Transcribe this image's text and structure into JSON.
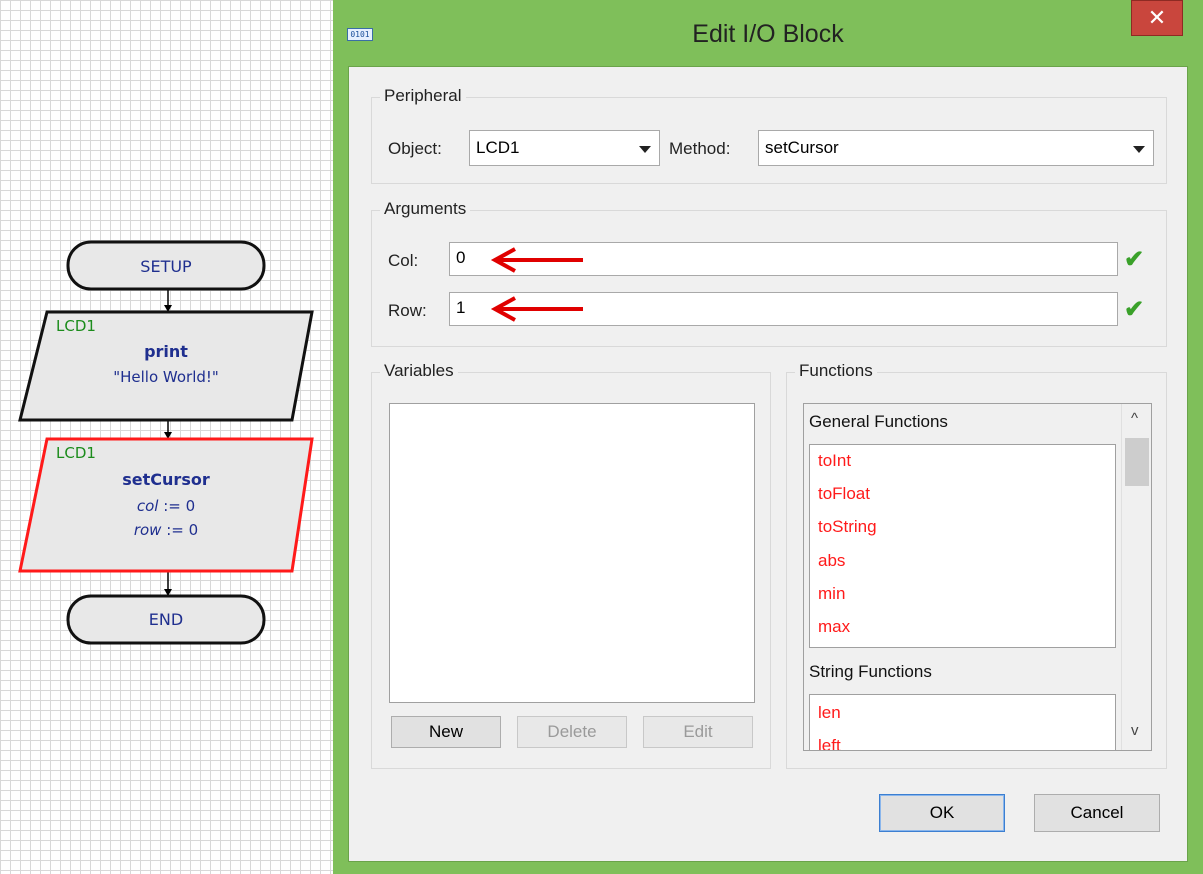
{
  "flowchart": {
    "setup_label": "SETUP",
    "end_label": "END",
    "block1": {
      "object": "LCD1",
      "method": "print",
      "arg": "\"Hello World!\""
    },
    "block2": {
      "object": "LCD1",
      "method": "setCursor",
      "arg1_name": "col",
      "arg1_value": " := 0",
      "arg2_name": "row",
      "arg2_value": " := 0"
    }
  },
  "dialog": {
    "app_icon_text": "0101",
    "title": "Edit I/O Block",
    "close_glyph": "✕",
    "peripheral": {
      "group_title": "Peripheral",
      "object_label": "Object:",
      "object_value": "LCD1",
      "method_label": "Method:",
      "method_value": "setCursor"
    },
    "arguments": {
      "group_title": "Arguments",
      "col_label": "Col:",
      "col_value": "0",
      "row_label": "Row:",
      "row_value": "1",
      "valid_glyph": "✔"
    },
    "variables": {
      "group_title": "Variables",
      "new_label": "New",
      "delete_label": "Delete",
      "edit_label": "Edit"
    },
    "functions": {
      "group_title": "Functions",
      "general_header": "General Functions",
      "general_items": [
        "toInt",
        "toFloat",
        "toString",
        "abs",
        "min",
        "max"
      ],
      "string_header": "String Functions",
      "string_items": [
        "len",
        "left"
      ],
      "scroll_up_glyph": "^",
      "scroll_down_glyph": "v"
    },
    "ok_label": "OK",
    "cancel_label": "Cancel"
  },
  "colors": {
    "title_bar": "#7fbf5a",
    "close_button": "#c9463d",
    "function_text": "#ff1a1a",
    "selected_block_outline": "#ff1a1a",
    "annotation_arrow": "#e00000",
    "valid_check": "#3aa12a"
  }
}
